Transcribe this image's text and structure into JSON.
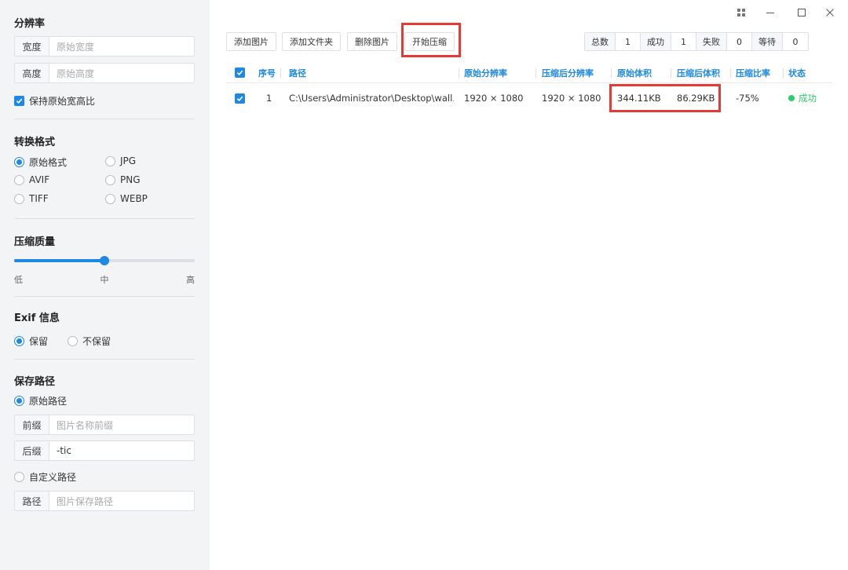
{
  "sidebar": {
    "resolution": {
      "title": "分辨率",
      "width_label": "宽度",
      "width_placeholder": "原始宽度",
      "height_label": "高度",
      "height_placeholder": "原始高度",
      "keep_ratio_label": "保持原始宽高比",
      "keep_ratio_checked": true
    },
    "format": {
      "title": "转换格式",
      "options": [
        "原始格式",
        "JPG",
        "AVIF",
        "PNG",
        "TIFF",
        "WEBP"
      ],
      "selected": "原始格式"
    },
    "quality": {
      "title": "压缩质量",
      "low": "低",
      "mid": "中",
      "high": "高",
      "value_fraction": 0.5
    },
    "exif": {
      "title": "Exif 信息",
      "keep": "保留",
      "no_keep": "不保留",
      "selected": "保留"
    },
    "save": {
      "title": "保存路径",
      "original_path": "原始路径",
      "prefix_label": "前缀",
      "prefix_placeholder": "图片名称前缀",
      "suffix_label": "后缀",
      "suffix_value": "-tic",
      "custom_path": "自定义路径",
      "path_label": "路径",
      "path_placeholder": "图片保存路径",
      "selected": "原始路径"
    }
  },
  "toolbar": {
    "add_image": "添加图片",
    "add_folder": "添加文件夹",
    "delete_image": "删除图片",
    "start_compress": "开始压缩"
  },
  "stats": {
    "total_label": "总数",
    "total": "1",
    "success_label": "成功",
    "success": "1",
    "fail_label": "失败",
    "fail": "0",
    "wait_label": "等待",
    "wait": "0"
  },
  "table": {
    "headers": [
      "序号",
      "路径",
      "原始分辨率",
      "压缩后分辨率",
      "原始体积",
      "压缩后体积",
      "压缩比率",
      "状态"
    ],
    "rows": [
      {
        "index": "1",
        "path": "C:\\Users\\Administrator\\Desktop\\wall...",
        "orig_res": "1920 × 1080",
        "new_res": "1920 × 1080",
        "orig_size": "344.11KB",
        "new_size": "86.29KB",
        "ratio": "-75%",
        "status": "成功"
      }
    ]
  },
  "colors": {
    "accent": "#1e88e5",
    "highlight": "#e53935",
    "success": "#2ecc71"
  }
}
